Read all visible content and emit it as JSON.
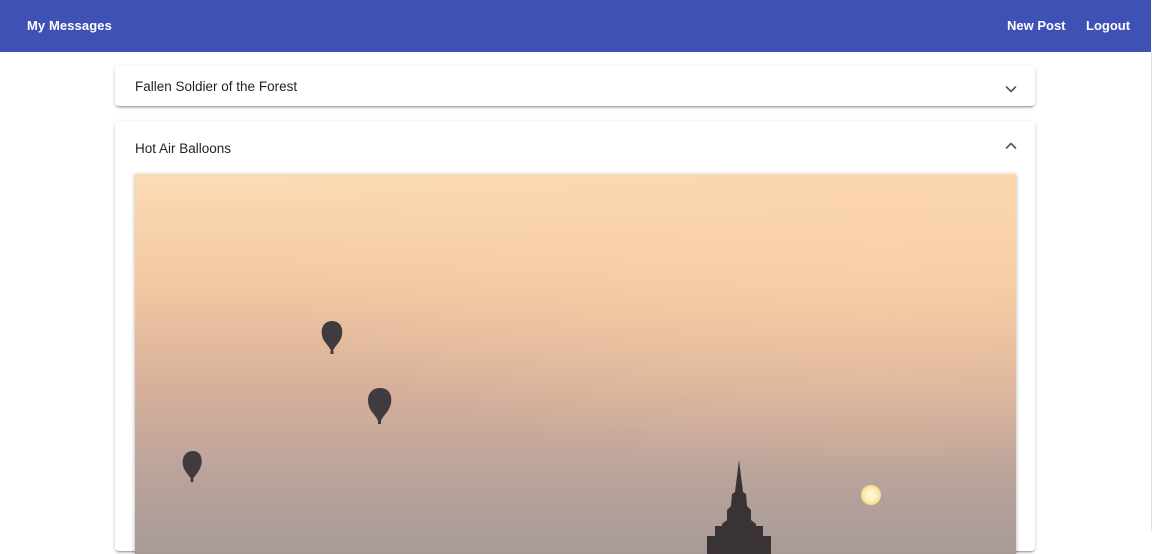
{
  "toolbar": {
    "brand": "My Messages",
    "new_post": "New Post",
    "logout": "Logout",
    "color": "#3f51b5"
  },
  "posts": [
    {
      "title": "Fallen Soldier of the Forest",
      "expanded": false,
      "icon": "chevron-down-icon"
    },
    {
      "title": "Hot Air Balloons",
      "expanded": true,
      "icon": "chevron-up-icon",
      "image": "sunset-sky-hot-air-balloons-photo"
    }
  ]
}
